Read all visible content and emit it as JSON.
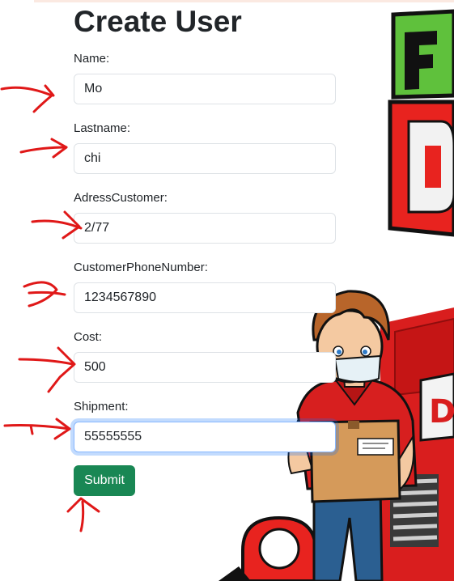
{
  "form": {
    "title": "Create User",
    "fields": [
      {
        "label": "Name:",
        "value": "Mo"
      },
      {
        "label": "Lastname:",
        "value": "chi"
      },
      {
        "label": "AdressCustomer:",
        "value": "2/77"
      },
      {
        "label": "CustomerPhoneNumber:",
        "value": "1234567890"
      },
      {
        "label": "Cost:",
        "value": "500"
      },
      {
        "label": "Shipment:",
        "value": "55555555"
      }
    ],
    "submit_label": "Submit"
  },
  "colors": {
    "submit_bg": "#198754",
    "focus_border": "#86b7fe",
    "annotation_arrow": "#e01818",
    "sign_green": "#5fc13c",
    "sign_red": "#e8231f"
  },
  "icons": {
    "annotation": "red-hand-drawn-arrow",
    "background": "delivery-person-illustration"
  }
}
